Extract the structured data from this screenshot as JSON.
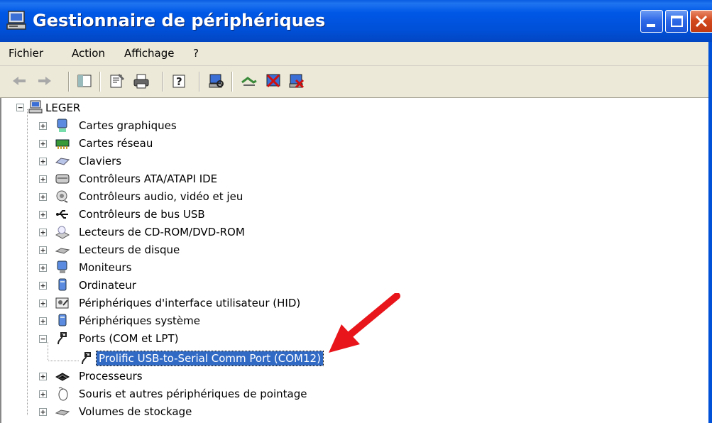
{
  "window": {
    "title": "Gestionnaire de périphériques"
  },
  "menu": {
    "items": [
      "Fichier",
      "Action",
      "Affichage",
      "?"
    ]
  },
  "toolbar": {
    "icons": [
      "back-icon",
      "forward-icon",
      "show-hide-tree-icon",
      "properties-icon",
      "print-icon",
      "help-icon",
      "scan-hardware-icon",
      "update-driver-icon",
      "disable-device-icon",
      "uninstall-device-icon"
    ]
  },
  "tree": {
    "root": {
      "label": "LEGER"
    },
    "categories": [
      {
        "label": "Cartes graphiques"
      },
      {
        "label": "Cartes réseau"
      },
      {
        "label": "Claviers"
      },
      {
        "label": "Contrôleurs ATA/ATAPI IDE"
      },
      {
        "label": "Contrôleurs audio, vidéo et jeu"
      },
      {
        "label": "Contrôleurs de bus USB"
      },
      {
        "label": "Lecteurs de CD-ROM/DVD-ROM"
      },
      {
        "label": "Lecteurs de disque"
      },
      {
        "label": "Moniteurs"
      },
      {
        "label": "Ordinateur"
      },
      {
        "label": "Périphériques d'interface utilisateur (HID)"
      },
      {
        "label": "Périphériques système"
      },
      {
        "label": "Ports (COM et LPT)"
      },
      {
        "label": "Processeurs"
      },
      {
        "label": "Souris et autres périphériques de pointage"
      },
      {
        "label": "Volumes de stockage"
      }
    ],
    "ports_child": {
      "label": "Prolific USB-to-Serial Comm Port (COM12)"
    }
  },
  "colors": {
    "titlebar": "#0050d8",
    "selection": "#316ac5",
    "annotation_arrow": "#e8151b"
  }
}
